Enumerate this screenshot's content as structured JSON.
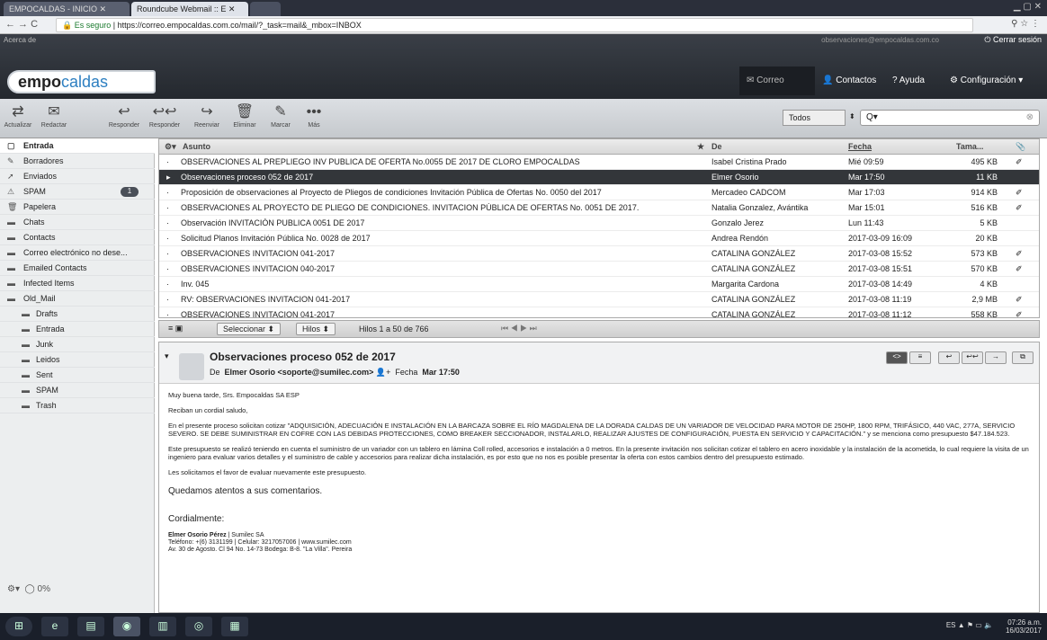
{
  "browser": {
    "tabs": [
      {
        "label": "EMPOCALDAS - INICIO"
      },
      {
        "label": "Roundcube Webmail :: E"
      }
    ],
    "secure_label": "Es seguro",
    "url": "https://correo.empocaldas.com.co/mail/?_task=mail&_mbox=INBOX"
  },
  "header": {
    "about": "Acerca de",
    "user_email": "observaciones@empocaldas.com.co",
    "logout": "Cerrar sesión",
    "logo_a": "empo",
    "logo_b": "caldas",
    "nav": {
      "mail": "Correo",
      "contacts": "Contactos",
      "help": "Ayuda",
      "settings": "Configuración"
    }
  },
  "toolbar": {
    "refresh": "Actualizar",
    "compose": "Redactar",
    "reply": "Responder",
    "reply_all": "Responder",
    "forward": "Reenviar",
    "delete": "Eliminar",
    "mark": "Marcar",
    "more": "Más",
    "filter": "Todos",
    "search_placeholder": "Q▾"
  },
  "sidebar": {
    "folders": [
      {
        "name": "Entrada",
        "selected": true
      },
      {
        "name": "Borradores"
      },
      {
        "name": "Enviados"
      },
      {
        "name": "SPAM",
        "badge": "1"
      },
      {
        "name": "Papelera"
      },
      {
        "name": "Chats"
      },
      {
        "name": "Contacts"
      },
      {
        "name": "Correo electrónico no dese..."
      },
      {
        "name": "Emailed Contacts"
      },
      {
        "name": "Infected Items"
      },
      {
        "name": "Old_Mail"
      },
      {
        "name": "Drafts",
        "sub": true
      },
      {
        "name": "Entrada",
        "sub": true
      },
      {
        "name": "Junk",
        "sub": true
      },
      {
        "name": "Leidos",
        "sub": true
      },
      {
        "name": "Sent",
        "sub": true
      },
      {
        "name": "SPAM",
        "sub": true
      },
      {
        "name": "Trash",
        "sub": true
      }
    ],
    "quota": "0%"
  },
  "list": {
    "headers": {
      "subject": "Asunto",
      "from": "De",
      "date": "Fecha",
      "size": "Tama..."
    },
    "rows": [
      {
        "subject": "OBSERVACIONES AL PREPLIEGO INV PUBLICA DE OFERTA No.0055 DE 2017 DE CLORO EMPOCALDAS",
        "from": "Isabel Cristina Prado",
        "date": "Mié 09:59",
        "size": "495 KB",
        "att": true
      },
      {
        "subject": "Observaciones proceso 052 de 2017",
        "from": "Elmer Osorio",
        "date": "Mar 17:50",
        "size": "11 KB",
        "selected": true
      },
      {
        "subject": "Proposición de observaciones al Proyecto de Pliegos de condiciones Invitación Pública de Ofertas No. 0050 del 2017",
        "from": "Mercadeo CADCOM",
        "date": "Mar 17:03",
        "size": "914 KB",
        "att": true
      },
      {
        "subject": "OBSERVACIONES AL PROYECTO DE PLIEGO DE CONDICIONES. INVITACION PÚBLICA DE OFERTAS No. 0051 DE 2017.",
        "from": "Natalia Gonzalez, Avántika",
        "date": "Mar 15:01",
        "size": "516 KB",
        "att": true
      },
      {
        "subject": "Observación INVITACIÓN PUBLICA 0051 DE 2017",
        "from": "Gonzalo Jerez",
        "date": "Lun 11:43",
        "size": "5 KB"
      },
      {
        "subject": "Solicitud Planos Invitación Pública No. 0028 de 2017",
        "from": "Andrea Rendón",
        "date": "2017-03-09 16:09",
        "size": "20 KB"
      },
      {
        "subject": "OBSERVACIONES INVITACION 041-2017",
        "from": "CATALINA GONZÁLEZ",
        "date": "2017-03-08 15:52",
        "size": "573 KB",
        "att": true
      },
      {
        "subject": "OBSERVACIONES INVITACION 040-2017",
        "from": "CATALINA GONZÁLEZ",
        "date": "2017-03-08 15:51",
        "size": "570 KB",
        "att": true
      },
      {
        "subject": "Inv. 045",
        "from": "Margarita Cardona",
        "date": "2017-03-08 14:49",
        "size": "4 KB"
      },
      {
        "subject": "RV: OBSERVACIONES INVITACION 041-2017",
        "from": "CATALINA GONZÁLEZ",
        "date": "2017-03-08 11:19",
        "size": "2,9 MB",
        "att": true
      },
      {
        "subject": "OBSERVACIONES INVITACION 041-2017",
        "from": "CATALINA GONZÁLEZ",
        "date": "2017-03-08 11:12",
        "size": "558 KB",
        "att": true
      }
    ],
    "footer": {
      "select": "Seleccionar",
      "threads": "Hilos",
      "count": "Hilos 1 a 50 de 766"
    }
  },
  "preview": {
    "subject": "Observaciones proceso 052 de 2017",
    "from_label": "De",
    "from": "Elmer Osorio <soporte@sumilec.com>",
    "date_label": "Fecha",
    "date": "Mar 17:50",
    "body": [
      "Muy buena tarde, Srs. Empocaldas SA ESP",
      "Reciban un cordial saludo,",
      "En el presente proceso solicitan cotizar \"ADQUISICIÓN, ADECUACIÓN E INSTALACIÓN EN LA BARCAZA SOBRE EL RÍO MAGDALENA DE LA DORADA CALDAS DE UN VARIADOR DE VELOCIDAD PARA MOTOR DE 250HP, 1800 RPM, TRIFÁSICO, 440 VAC, 277A, SERVICIO SEVERO. SE DEBE SUMINISTRAR EN COFRE CON LAS DEBIDAS PROTECCIONES, COMO BREAKER SECCIONADOR, INSTALARLO, REALIZAR AJUSTES DE CONFIGURACIÓN, PUESTA EN SERVICIO Y CAPACITACIÓN.\" y se menciona como presupuesto $47.184.523.",
      "Este presupuesto se realizó teniendo en cuenta el suministro de un variador con un tablero en lámina Coll rolled, accesorios e instalación a 0 metros. En la presente invitación nos solicitan cotizar el tablero en acero inoxidable y la instalación de la acometida, lo cual requiere la visita de un ingeniero para evaluar varios detalles y el suministro de cable y accesorios para realizar dicha instalación, es por esto que no nos es posible presentar la oferta con estos cambios dentro del presupuesto estimado.",
      "Les solicitamos el favor de evaluar nuevamente este presupuesto."
    ],
    "closing1": "Quedamos atentos a sus comentarios.",
    "closing2": "Cordialmente:",
    "sig_name": "Elmer Osorio Pérez",
    "sig_company": "| Sumilec SA",
    "sig_phone": "Teléfono: +(6) 3131199 | Celular: 3217057006 | www.sumilec.com",
    "sig_addr": "Av. 30 de Agosto. Cl 94 No. 14-73 Bodega: B-8. \"La Villa\". Pereira"
  },
  "taskbar": {
    "lang": "ES",
    "time": "07:26 a.m.",
    "date": "16/03/2017"
  }
}
